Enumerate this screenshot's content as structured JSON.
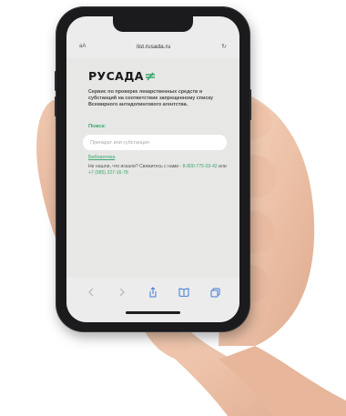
{
  "browser": {
    "aa_label": "aA",
    "url": "list.rusada.ru",
    "reload_glyph": "↻"
  },
  "site": {
    "logo_text": "РУСАДА",
    "description": "Сервис по проверке лекарственных средств и субстанций на соответствие запрещенному списку Всемирного антидопингового агентства.",
    "search_label": "Поиск:",
    "search_placeholder": "Препарат или субстанция",
    "library_link": "Библиотека",
    "contact_prefix": "Не нашли, что искали? Свяжитесь с нами - ",
    "contact_phone_1": "8-800-775-03-42",
    "contact_middle": " или ",
    "contact_phone_2": "+7 (985) 227-16-78"
  },
  "toolbar": {
    "icons": [
      "chevron-left-icon",
      "chevron-right-icon",
      "share-icon",
      "bookmarks-icon",
      "tabs-icon"
    ]
  },
  "colors": {
    "accent": "#3aa76d",
    "phone_body": "#1b1b1d",
    "screen_bg": "#ececec"
  }
}
